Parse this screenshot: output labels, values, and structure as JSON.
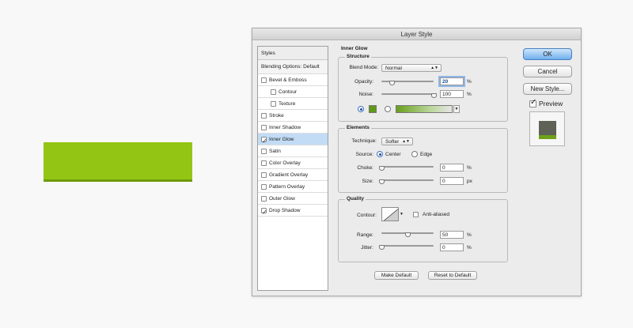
{
  "colors": {
    "preview_bar": "#93c614",
    "glow_swatch": "#5f9a16",
    "selected_row": "#c2dcf6"
  },
  "dialog": {
    "title": "Layer Style",
    "styles_list": {
      "header": "Styles",
      "items": [
        {
          "label": "Blending Options: Default",
          "checked": null,
          "selected": false
        },
        {
          "label": "Bevel & Emboss",
          "checked": false,
          "selected": false
        },
        {
          "label": "Contour",
          "checked": false,
          "selected": false
        },
        {
          "label": "Texture",
          "checked": false,
          "selected": false
        },
        {
          "label": "Stroke",
          "checked": false,
          "selected": false
        },
        {
          "label": "Inner Shadow",
          "checked": false,
          "selected": false
        },
        {
          "label": "Inner Glow",
          "checked": true,
          "selected": true
        },
        {
          "label": "Satin",
          "checked": false,
          "selected": false
        },
        {
          "label": "Color Overlay",
          "checked": false,
          "selected": false
        },
        {
          "label": "Gradient Overlay",
          "checked": false,
          "selected": false
        },
        {
          "label": "Pattern Overlay",
          "checked": false,
          "selected": false
        },
        {
          "label": "Outer Glow",
          "checked": false,
          "selected": false
        },
        {
          "label": "Drop Shadow",
          "checked": true,
          "selected": false
        }
      ]
    },
    "inner_glow": {
      "title": "Inner Glow",
      "structure": {
        "title": "Structure",
        "blend_mode_label": "Blend Mode:",
        "blend_mode_value": "Normal",
        "opacity_label": "Opacity:",
        "opacity_value": "20",
        "opacity_unit": "%",
        "opacity_fraction": 0.2,
        "noise_label": "Noise:",
        "noise_value": "100",
        "noise_unit": "%",
        "noise_fraction": 1.0,
        "color_mode": "solid"
      },
      "elements": {
        "title": "Elements",
        "technique_label": "Technique:",
        "technique_value": "Softer",
        "source_label": "Source:",
        "source_center": "Center",
        "source_edge": "Edge",
        "source_selected": "center",
        "choke_label": "Choke:",
        "choke_value": "0",
        "choke_unit": "%",
        "choke_fraction": 0,
        "size_label": "Size:",
        "size_value": "0",
        "size_unit": "px",
        "size_fraction": 0
      },
      "quality": {
        "title": "Quality",
        "contour_label": "Contour:",
        "anti_aliased_label": "Anti-aliased",
        "anti_aliased_checked": false,
        "range_label": "Range:",
        "range_value": "50",
        "range_unit": "%",
        "range_fraction": 0.5,
        "jitter_label": "Jitter:",
        "jitter_value": "0",
        "jitter_unit": "%",
        "jitter_fraction": 0
      },
      "make_default": "Make Default",
      "reset_to_default": "Reset to Default"
    },
    "buttons": {
      "ok": "OK",
      "cancel": "Cancel",
      "new_style": "New Style...",
      "preview": "Preview",
      "preview_checked": true
    }
  }
}
